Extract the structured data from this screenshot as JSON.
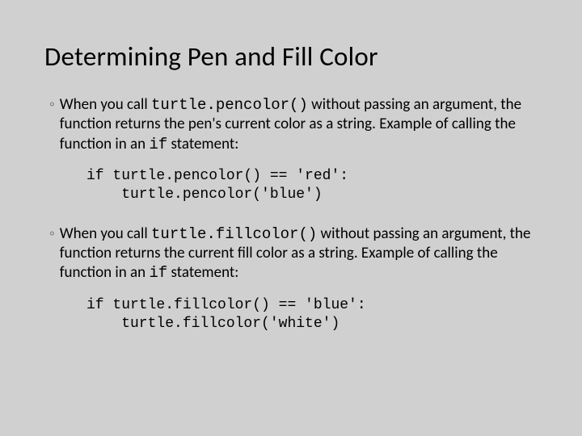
{
  "title": "Determining Pen and Fill Color",
  "bullets": [
    {
      "pre": "When you call ",
      "code1": "turtle.pencolor()",
      "mid": " without passing an argument, the function returns the pen's current color as a string. Example of calling the function in an ",
      "code2": "if",
      "post": " statement:"
    },
    {
      "pre": "When you call ",
      "code1": "turtle.fillcolor()",
      "mid": " without passing an argument, the function returns the current fill color as a string. Example of calling the function in an ",
      "code2": "if",
      "post": " statement:"
    }
  ],
  "codeblocks": [
    "if turtle.pencolor() == 'red':\n    turtle.pencolor('blue')",
    "if turtle.fillcolor() == 'blue':\n    turtle.fillcolor('white')"
  ],
  "bullet_symbol": "◦"
}
